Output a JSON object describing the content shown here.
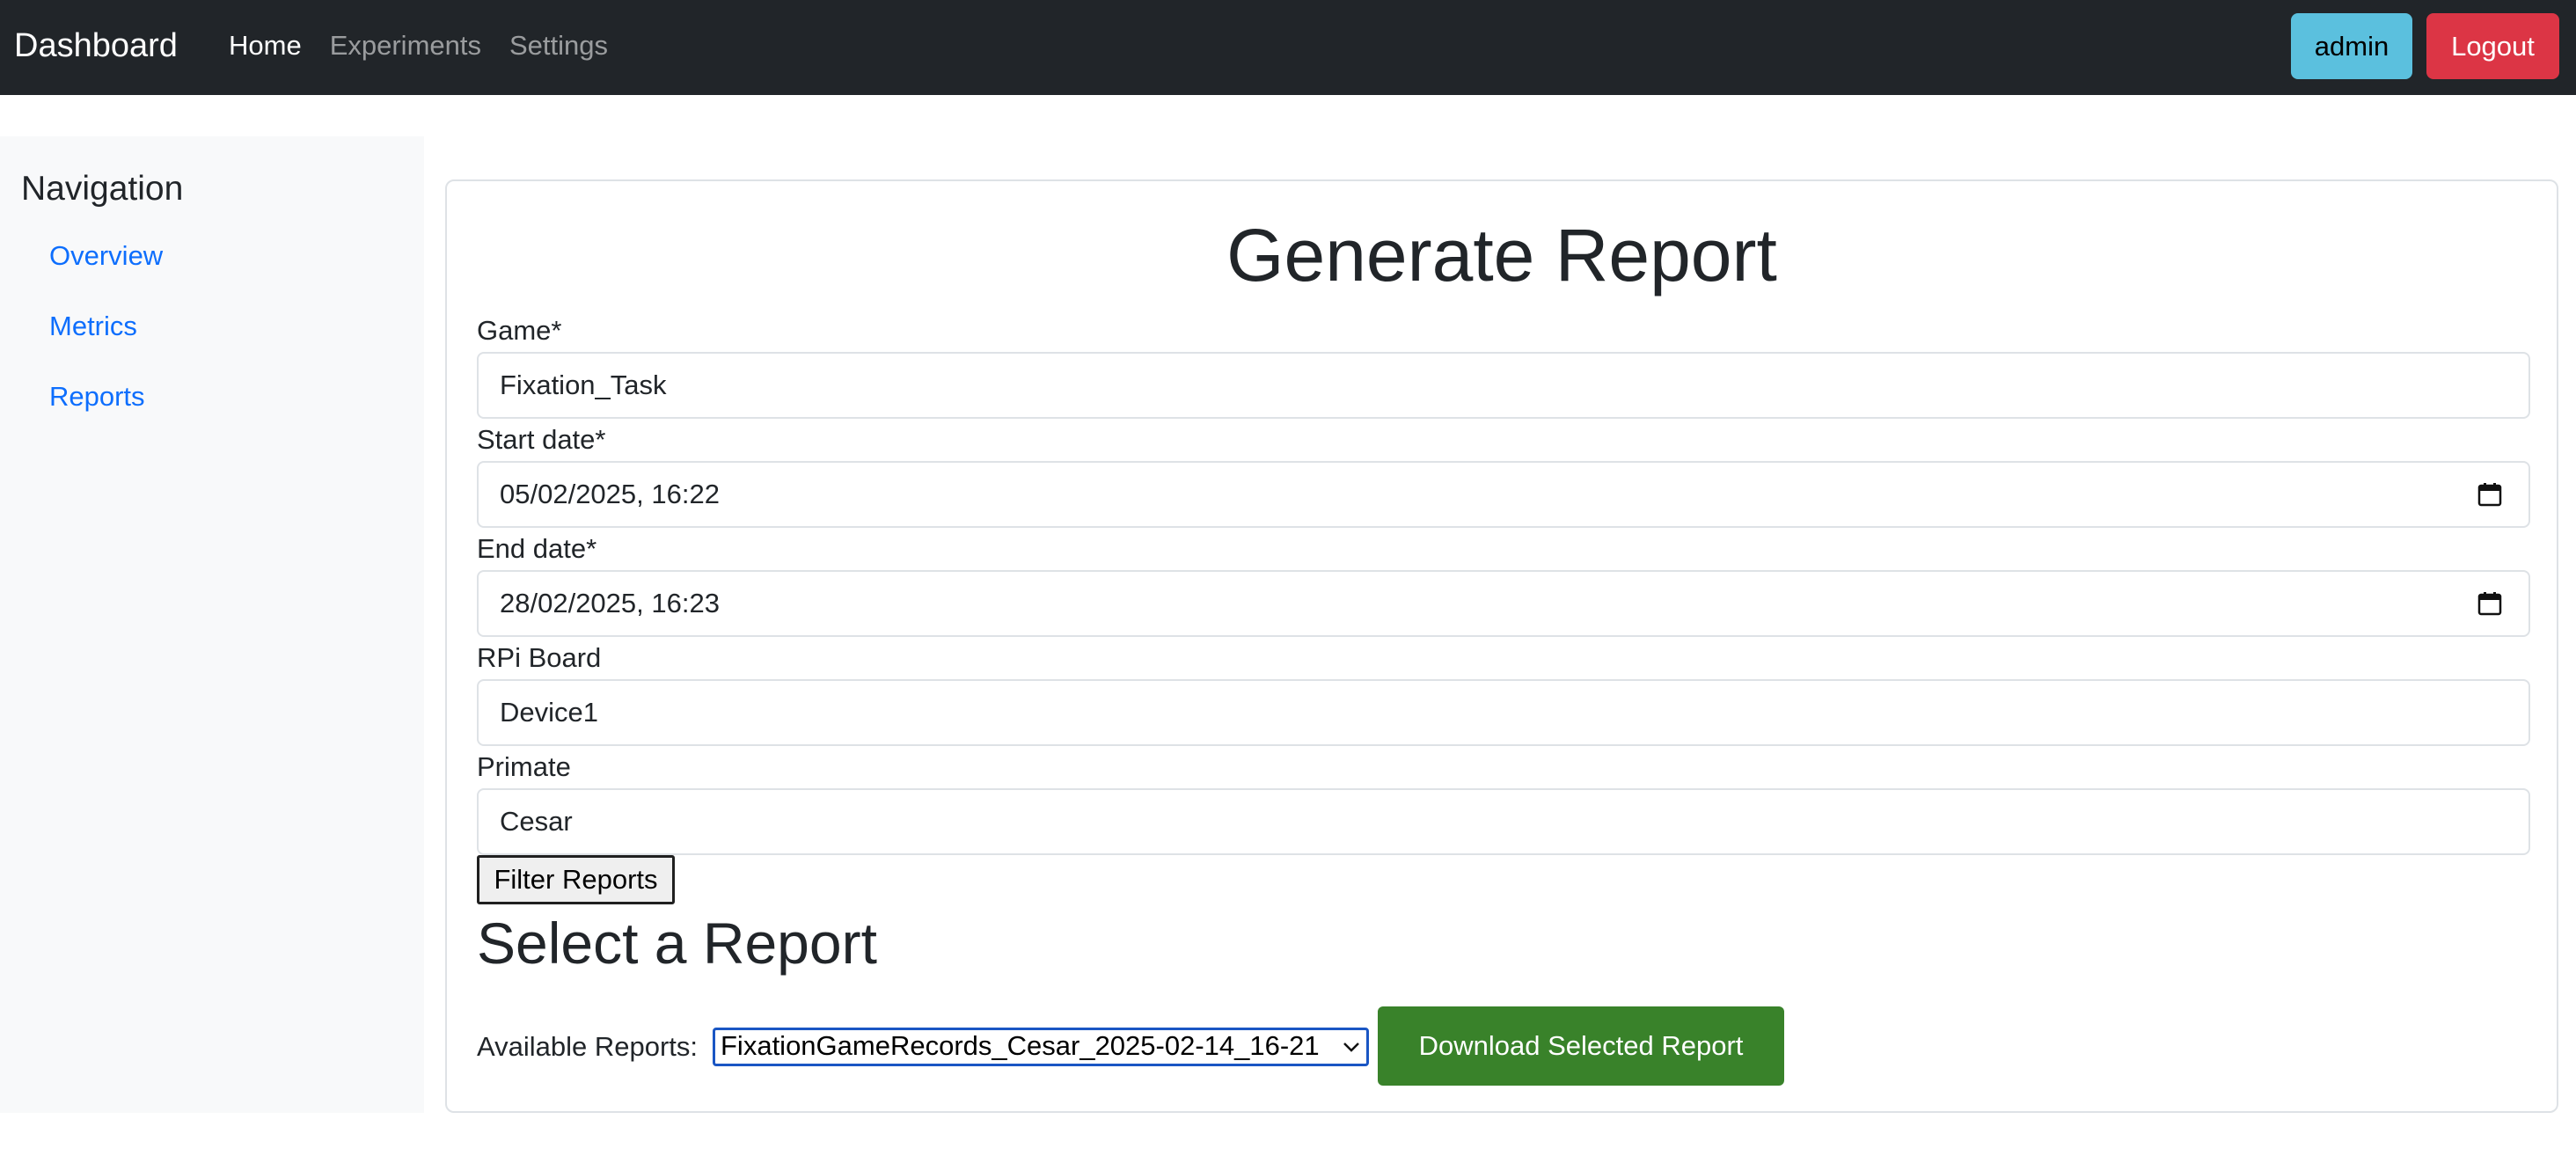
{
  "navbar": {
    "brand": "Dashboard",
    "links": [
      {
        "label": "Home",
        "active": true
      },
      {
        "label": "Experiments",
        "active": false
      },
      {
        "label": "Settings",
        "active": false
      }
    ],
    "admin_label": "admin",
    "logout_label": "Logout"
  },
  "sidebar": {
    "title": "Navigation",
    "items": [
      {
        "label": "Overview"
      },
      {
        "label": "Metrics"
      },
      {
        "label": "Reports"
      }
    ]
  },
  "form": {
    "title": "Generate Report",
    "game": {
      "label": "Game*",
      "value": "Fixation_Task"
    },
    "start_date": {
      "label": "Start date*",
      "value": "05/02/2025, 16:22",
      "icon": "calendar-icon"
    },
    "end_date": {
      "label": "End date*",
      "value": "28/02/2025, 16:23",
      "icon": "calendar-icon"
    },
    "board": {
      "label": "RPi Board",
      "value": "Device1"
    },
    "primate": {
      "label": "Primate",
      "value": "Cesar"
    },
    "filter_label": "Filter Reports"
  },
  "reports": {
    "title": "Select a Report",
    "available_label": "Available Reports:",
    "selected": "FixationGameRecords_Cesar_2025-02-14_16-21",
    "download_label": "Download Selected Report"
  },
  "colors": {
    "navbar_bg": "#212529",
    "admin_btn": "#5bc0de",
    "logout_btn": "#dc3545",
    "link": "#0d6efd",
    "download_btn": "#39822a"
  }
}
